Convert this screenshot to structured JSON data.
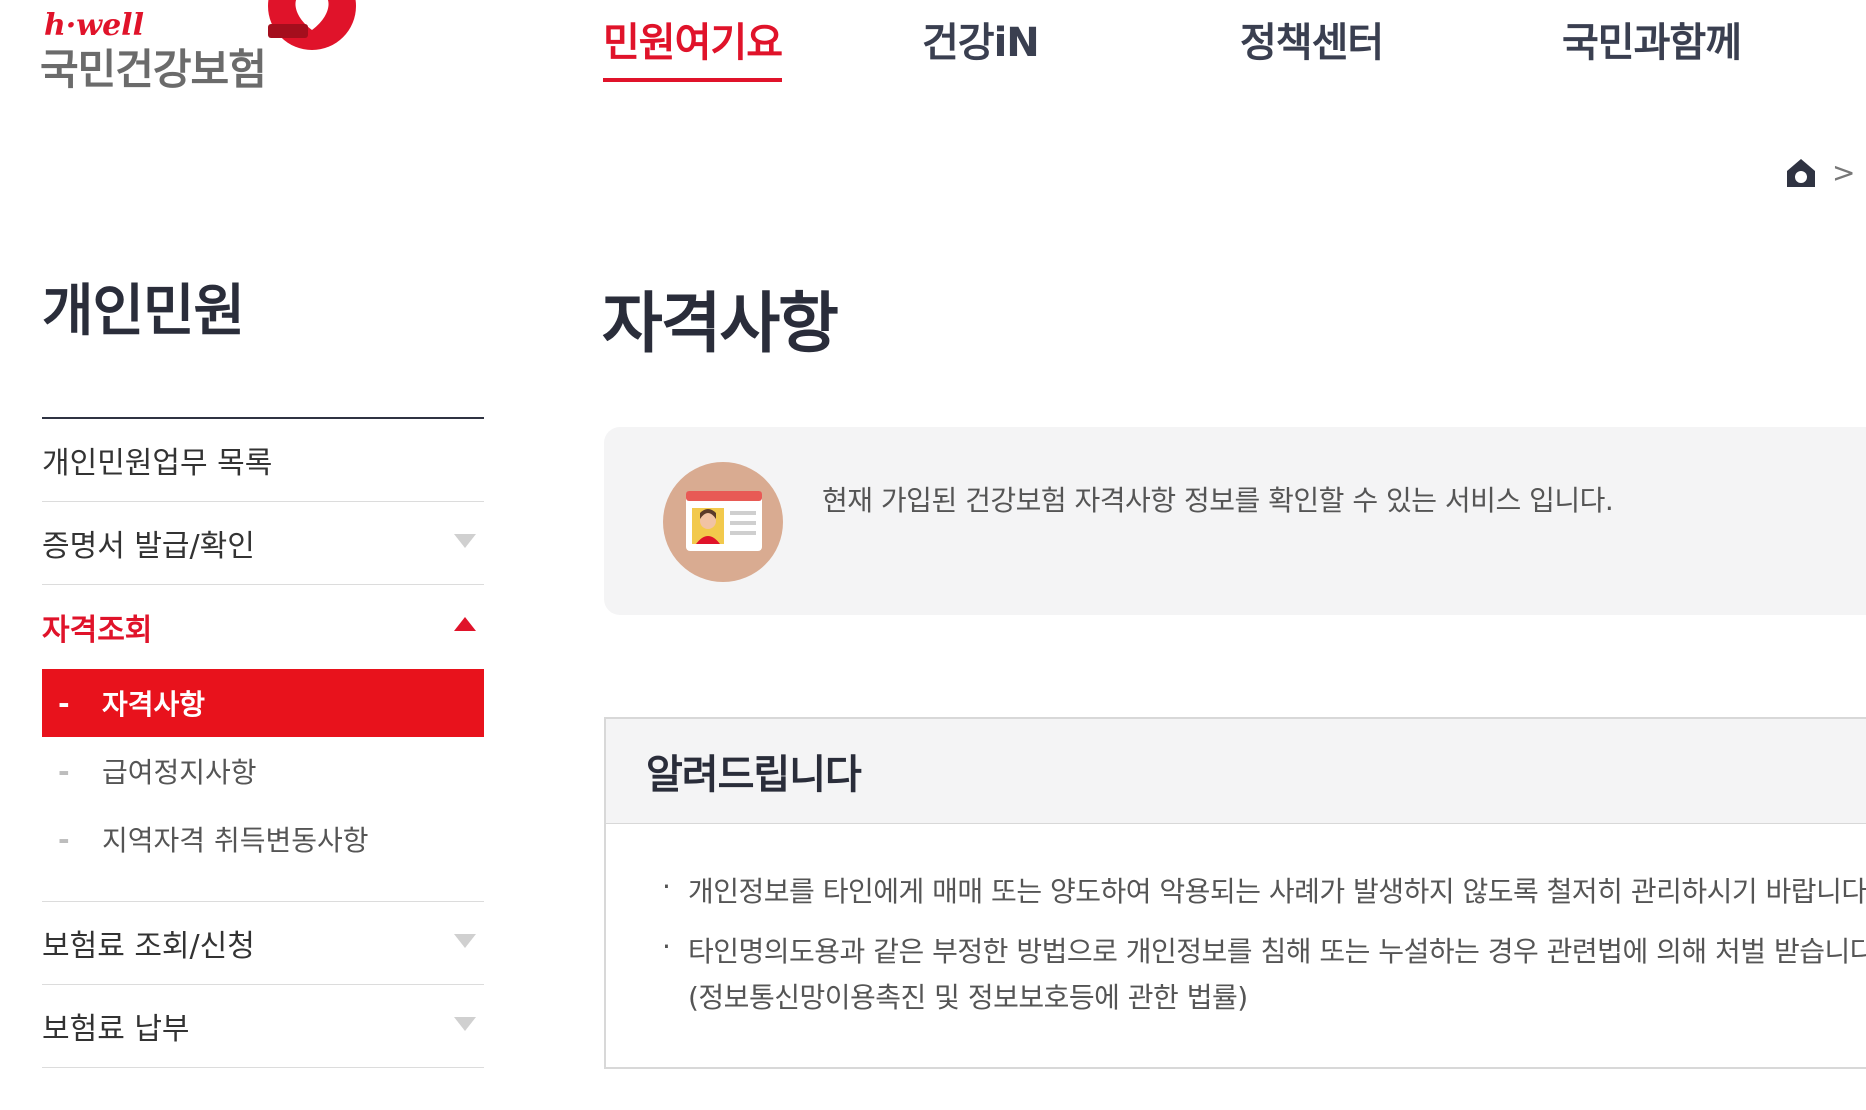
{
  "logo": {
    "script": "h·well",
    "name": "국민건강보험"
  },
  "gnb": [
    {
      "label": "민원여기요",
      "active": true
    },
    {
      "label": "건강iN",
      "active": false
    },
    {
      "label": "정책센터",
      "active": false
    },
    {
      "label": "국민과함께",
      "active": false
    }
  ],
  "breadcrumb": {
    "home_icon": "home-icon",
    "separator": ">"
  },
  "sidebar": {
    "title": "개인민원",
    "items": [
      {
        "label": "개인민원업무 목록"
      },
      {
        "label": "증명서 발급/확인"
      },
      {
        "label": "자격조회"
      },
      {
        "label": "보험료 조회/신청"
      },
      {
        "label": "보험료 납부"
      }
    ],
    "sub_items": [
      {
        "label": "자격사항",
        "dash": "-",
        "active": true
      },
      {
        "label": "급여정지사항",
        "dash": "-",
        "active": false
      },
      {
        "label": "지역자격 취득변동사항",
        "dash": "-",
        "active": false
      }
    ]
  },
  "main": {
    "title": "자격사항",
    "intro": "현재 가입된 건강보험 자격사항 정보를 확인할 수 있는 서비스 입니다.",
    "intro_icon": "id-card-icon",
    "notice": {
      "title": "알려드립니다",
      "bullet": "·",
      "lines": [
        "개인정보를 타인에게 매매 또는 양도하여 악용되는 사례가 발생하지 않도록 철저히 관리하시기 바랍니다",
        "타인명의도용과 같은 부정한 방법으로 개인정보를 침해 또는 누설하는 경우 관련법에 의해 처벌 받습니다",
        "(정보통신망이용촉진 및 정보보호등에 관한 법률)"
      ]
    }
  },
  "colors": {
    "accent": "#e0132a",
    "active_bg": "#e8121c",
    "panel_bg": "#f4f4f5",
    "title": "#2a2d3a"
  }
}
